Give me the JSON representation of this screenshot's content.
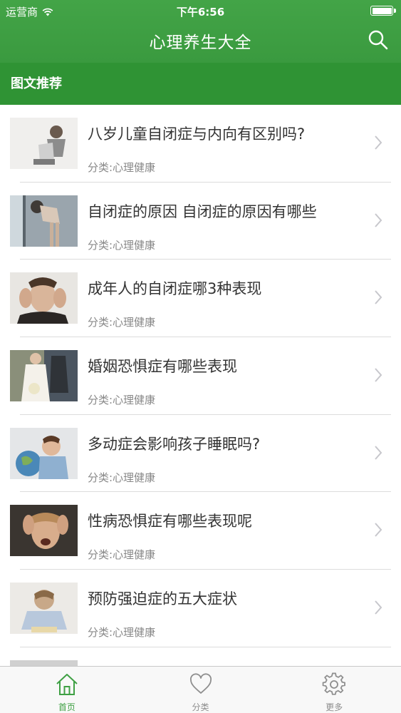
{
  "status_bar": {
    "carrier": "运营商",
    "time": "下午6:56"
  },
  "header": {
    "title": "心理养生大全",
    "search_icon": "search-icon"
  },
  "section": {
    "title": "图文推荐"
  },
  "articles": [
    {
      "title": "八岁儿童自闭症与内向有区别吗?",
      "category": "分类:心理健康"
    },
    {
      "title": "自闭症的原因  自闭症的原因有哪些",
      "category": "分类:心理健康"
    },
    {
      "title": "成年人的自闭症哪3种表现",
      "category": "分类:心理健康"
    },
    {
      "title": "婚姻恐惧症有哪些表现",
      "category": "分类:心理健康"
    },
    {
      "title": "多动症会影响孩子睡眠吗?",
      "category": "分类:心理健康"
    },
    {
      "title": "性病恐惧症有哪些表现呢",
      "category": "分类:心理健康"
    },
    {
      "title": "预防强迫症的五大症状",
      "category": "分类:心理健康"
    }
  ],
  "tabbar": {
    "tabs": [
      {
        "label": "首页",
        "icon": "home-icon",
        "active": true
      },
      {
        "label": "分类",
        "icon": "heart-icon",
        "active": false
      },
      {
        "label": "更多",
        "icon": "gear-icon",
        "active": false
      }
    ]
  },
  "colors": {
    "accent": "#3fa044",
    "header": "#41a245",
    "section_bar": "#2f9334"
  }
}
